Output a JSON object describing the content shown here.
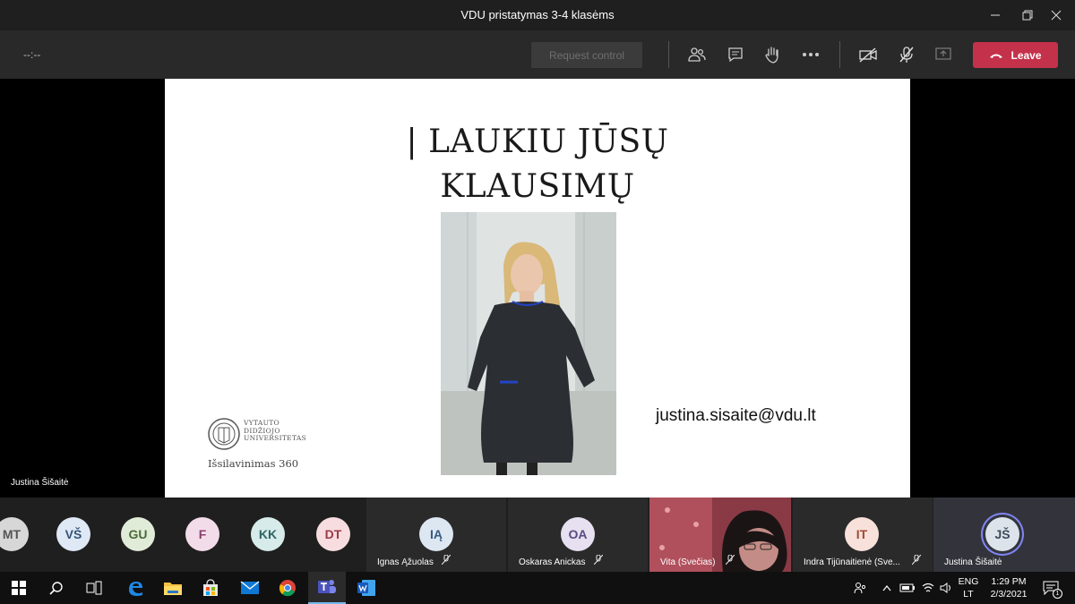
{
  "window": {
    "title": "VDU pristatymas 3-4 klasėms"
  },
  "toolbar": {
    "timer": "--:--",
    "request_control": "Request control",
    "leave_label": "Leave",
    "leave_color": "#c4314b"
  },
  "slide": {
    "title_line1": "| LAUKIU JŪSŲ",
    "title_line2": "KLAUSIMŲ",
    "email": "justina.sisaite@vdu.lt",
    "logo_lines": [
      "VYTAUTO",
      "DIDŽIOJO",
      "UNIVERSITETAS"
    ],
    "logo_tagline": "Išsilavinimas 360"
  },
  "stage": {
    "speaker_name": "Justina Šišaitė"
  },
  "participants": {
    "avatars": [
      {
        "initials": "MT",
        "bg": "#d7d7d7",
        "fg": "#555555"
      },
      {
        "initials": "VŠ",
        "bg": "#dfe8f5",
        "fg": "#33557a"
      },
      {
        "initials": "GU",
        "bg": "#e1ecd8",
        "fg": "#4d6a3a"
      },
      {
        "initials": "F",
        "bg": "#f3dcea",
        "fg": "#8a3f6c"
      },
      {
        "initials": "KK",
        "bg": "#d6ebea",
        "fg": "#2f6663"
      },
      {
        "initials": "DT",
        "bg": "#f7dde0",
        "fg": "#9b3a48"
      }
    ],
    "tiles": [
      {
        "initials": "IĄ",
        "name": "Ignas Ąžuolas",
        "bg": "#dde7f2",
        "fg": "#365a80"
      },
      {
        "initials": "OA",
        "name": "Oskaras Anickas",
        "bg": "#e6e0f0",
        "fg": "#5a4a80"
      },
      {
        "name": "Vita (Svečias)"
      },
      {
        "initials": "IT",
        "name": "Indra Tijūnaitienė (Svečias)",
        "display_name": "Indra Tijūnaitienė (Sve...",
        "bg": "#f7e1da",
        "fg": "#a04a33"
      },
      {
        "initials": "JŠ",
        "name": "Justina Šišaitė",
        "bg": "#dde3ea",
        "fg": "#3a4a5a"
      }
    ]
  },
  "taskbar": {
    "lang_top": "ENG",
    "lang_bottom": "LT",
    "time": "1:29 PM",
    "date": "2/3/2021",
    "notif_count": "1"
  }
}
